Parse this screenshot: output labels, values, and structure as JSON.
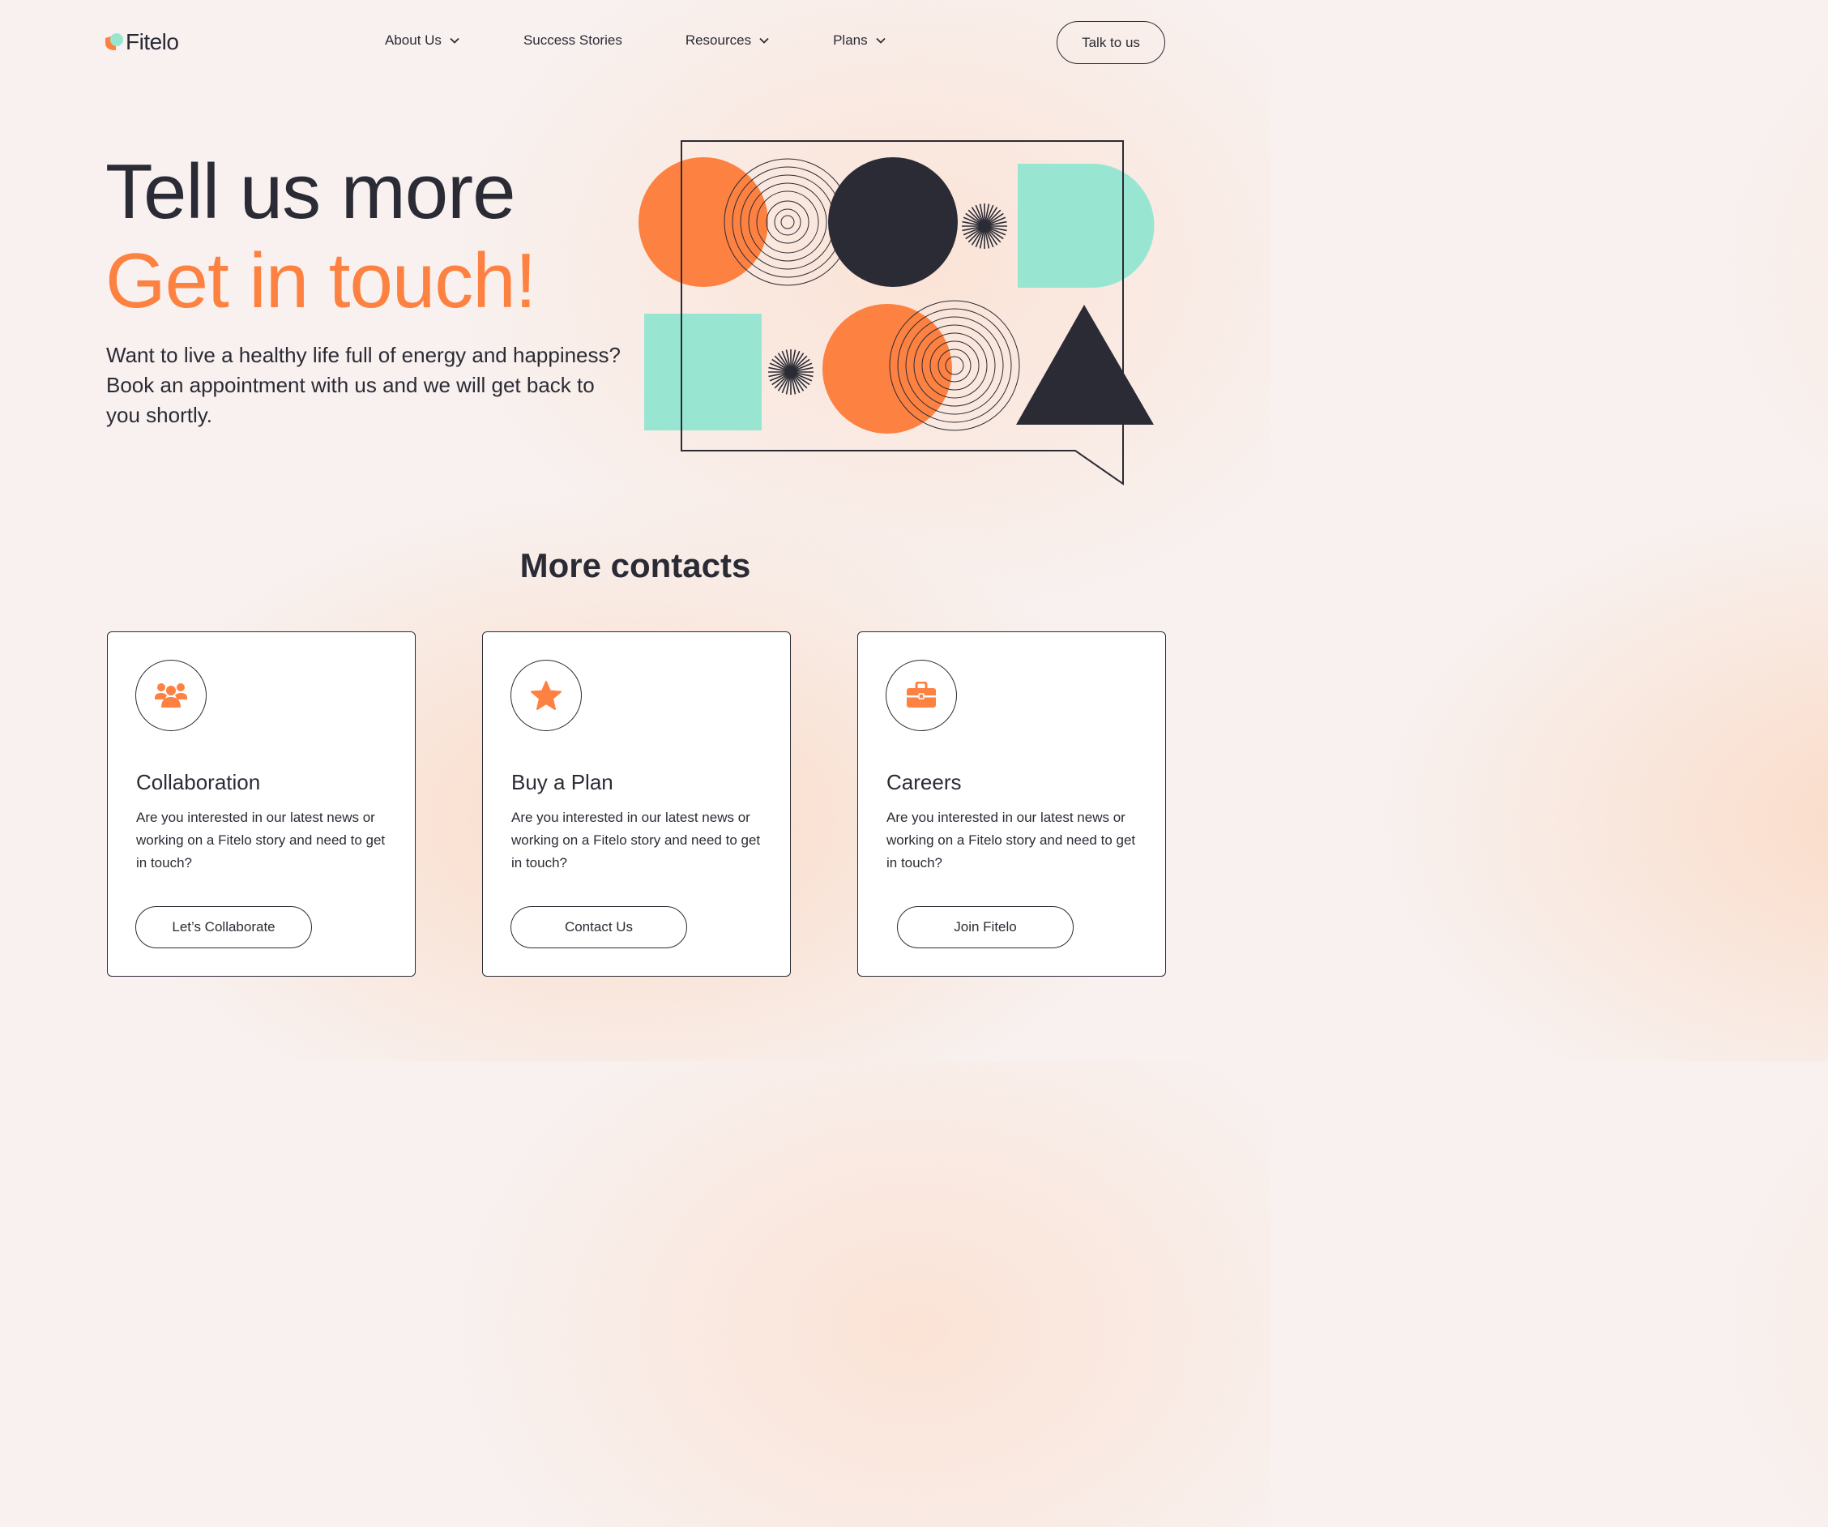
{
  "brand": {
    "name": "Fitelo",
    "accent": "#fd8140",
    "mint": "#98e6d1",
    "dark": "#2b2b35"
  },
  "nav": {
    "items": [
      {
        "label": "About Us",
        "dropdown": true
      },
      {
        "label": "Success Stories",
        "dropdown": false
      },
      {
        "label": "Resources",
        "dropdown": true
      },
      {
        "label": "Plans",
        "dropdown": true
      }
    ],
    "cta_label": "Talk to us"
  },
  "hero": {
    "line1": "Tell us more",
    "line2": "Get in touch!",
    "subtitle": "Want to live a healthy life full of energy and happiness? Book an appointment with us and we will get back to you shortly."
  },
  "contacts": {
    "title": "More contacts",
    "cards": [
      {
        "icon": "users-icon",
        "title": "Collaboration",
        "text": "Are you interested in our latest news or working on a Fitelo story and need to get in touch?",
        "button": "Let’s Collaborate"
      },
      {
        "icon": "star-icon",
        "title": "Buy a Plan",
        "text": "Are you interested in our latest news or working on a Fitelo story and need to get in touch?",
        "button": "Contact Us"
      },
      {
        "icon": "briefcase-icon",
        "title": "Careers",
        "text": "Are you interested in our latest news or working on a Fitelo story and need to get in touch?",
        "button": "Join Fitelo"
      }
    ]
  }
}
